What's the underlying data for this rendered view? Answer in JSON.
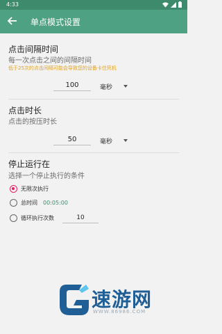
{
  "status_bar": {
    "time": "4:33",
    "wifi_icon": "wifi-icon",
    "signal_icon": "signal-icon",
    "battery_icon": "battery-icon"
  },
  "app_bar": {
    "back_icon": "arrow-back-icon",
    "title": "单点模式设置"
  },
  "interval": {
    "title": "点击间隔时间",
    "subtitle": "每一次点击之间的间隔时间",
    "warning": "低于25次的点击间隔可能会导致您的设备卡住死机",
    "value": "100",
    "unit": "毫秒"
  },
  "duration": {
    "title": "点击时长",
    "subtitle": "点击的按压时长",
    "value": "50",
    "unit": "毫秒"
  },
  "stop": {
    "title": "停止运行在",
    "subtitle": "选择一个停止执行的条件",
    "options": [
      {
        "label": "无限次执行",
        "checked": true
      },
      {
        "label": "总时间",
        "value": "00:05:00",
        "checked": false
      },
      {
        "label": "循环执行次数",
        "value": "10",
        "checked": false
      }
    ]
  },
  "watermark": {
    "text": "速游网",
    "url": "WWW.86986.COM"
  },
  "colors": {
    "status_bar": "#3d8b6c",
    "app_bar": "#4fa184",
    "accent": "#e91e63",
    "warning": "#e0a321"
  }
}
